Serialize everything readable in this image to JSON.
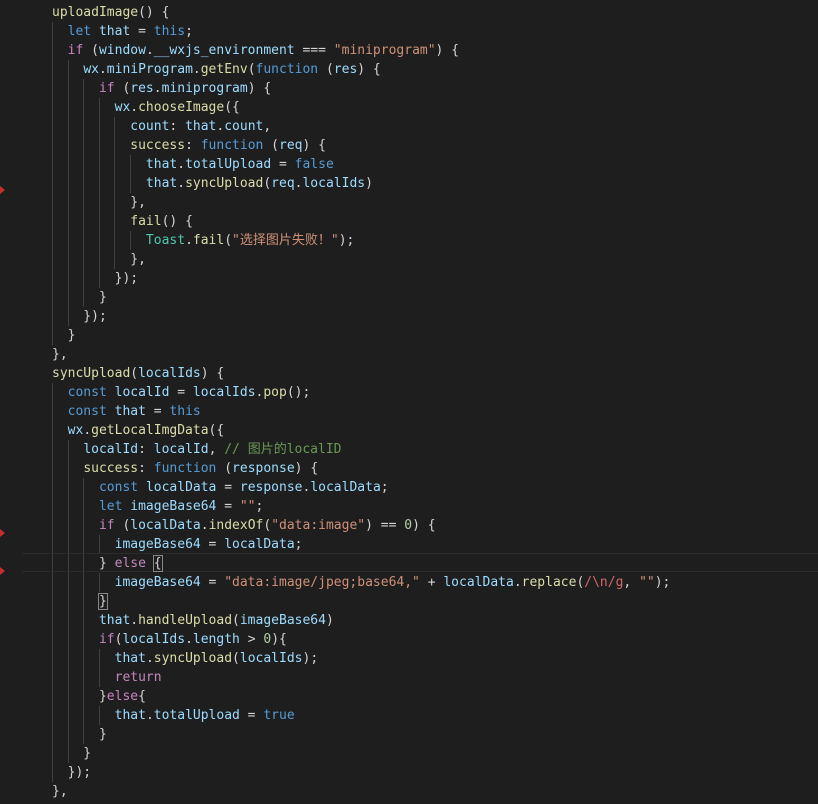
{
  "editor": {
    "theme_colors": {
      "background": "#1e1e1e",
      "function": "#dcdcaa",
      "keyword": "#569cd6",
      "control": "#c586c0",
      "variable": "#9cdcfe",
      "string": "#ce9178",
      "number": "#b5cea8",
      "comment": "#6a9955",
      "class": "#4ec9b0",
      "regex": "#d16969",
      "breakpoint_marker": "#c72e2e"
    },
    "lines": [
      [
        [
          "uploadImage",
          "fn"
        ],
        [
          "() {",
          "pl"
        ]
      ],
      [
        [
          "  ",
          "pl"
        ],
        [
          "let",
          "kw"
        ],
        [
          " ",
          "pl"
        ],
        [
          "that",
          "var"
        ],
        [
          " = ",
          "pl"
        ],
        [
          "this",
          "kw"
        ],
        [
          ";",
          "pl"
        ]
      ],
      [
        [
          "  ",
          "pl"
        ],
        [
          "if",
          "ctl"
        ],
        [
          " (",
          "pl"
        ],
        [
          "window",
          "var"
        ],
        [
          ".",
          "pl"
        ],
        [
          "__wxjs_environment",
          "var"
        ],
        [
          " === ",
          "pl"
        ],
        [
          "\"miniprogram\"",
          "str"
        ],
        [
          ") {",
          "pl"
        ]
      ],
      [
        [
          "    ",
          "pl"
        ],
        [
          "wx",
          "var"
        ],
        [
          ".",
          "pl"
        ],
        [
          "miniProgram",
          "var"
        ],
        [
          ".",
          "pl"
        ],
        [
          "getEnv",
          "fn"
        ],
        [
          "(",
          "pl"
        ],
        [
          "function",
          "kw"
        ],
        [
          " (",
          "pl"
        ],
        [
          "res",
          "var"
        ],
        [
          ") {",
          "pl"
        ]
      ],
      [
        [
          "      ",
          "pl"
        ],
        [
          "if",
          "ctl"
        ],
        [
          " (",
          "pl"
        ],
        [
          "res",
          "var"
        ],
        [
          ".",
          "pl"
        ],
        [
          "miniprogram",
          "var"
        ],
        [
          ") {",
          "pl"
        ]
      ],
      [
        [
          "        ",
          "pl"
        ],
        [
          "wx",
          "var"
        ],
        [
          ".",
          "pl"
        ],
        [
          "chooseImage",
          "fn"
        ],
        [
          "({",
          "pl"
        ]
      ],
      [
        [
          "          ",
          "pl"
        ],
        [
          "count",
          "var"
        ],
        [
          ": ",
          "pl"
        ],
        [
          "that",
          "var"
        ],
        [
          ".",
          "pl"
        ],
        [
          "count",
          "var"
        ],
        [
          ",",
          "pl"
        ]
      ],
      [
        [
          "          ",
          "pl"
        ],
        [
          "success",
          "fn"
        ],
        [
          ": ",
          "pl"
        ],
        [
          "function",
          "kw"
        ],
        [
          " (",
          "pl"
        ],
        [
          "req",
          "var"
        ],
        [
          ") {",
          "pl"
        ]
      ],
      [
        [
          "            ",
          "pl"
        ],
        [
          "that",
          "var"
        ],
        [
          ".",
          "pl"
        ],
        [
          "totalUpload",
          "var"
        ],
        [
          " = ",
          "pl"
        ],
        [
          "false",
          "kw"
        ]
      ],
      [
        [
          "            ",
          "pl"
        ],
        [
          "that",
          "var"
        ],
        [
          ".",
          "pl"
        ],
        [
          "syncUpload",
          "fn"
        ],
        [
          "(",
          "pl"
        ],
        [
          "req",
          "var"
        ],
        [
          ".",
          "pl"
        ],
        [
          "localIds",
          "var"
        ],
        [
          ")",
          "pl"
        ]
      ],
      [
        [
          "          },",
          "pl"
        ]
      ],
      [
        [
          "          ",
          "pl"
        ],
        [
          "fail",
          "fn"
        ],
        [
          "() {",
          "pl"
        ]
      ],
      [
        [
          "            ",
          "pl"
        ],
        [
          "Toast",
          "cls"
        ],
        [
          ".",
          "pl"
        ],
        [
          "fail",
          "fn"
        ],
        [
          "(",
          "pl"
        ],
        [
          "\"选择图片失败！\"",
          "str"
        ],
        [
          ");",
          "pl"
        ]
      ],
      [
        [
          "          },",
          "pl"
        ]
      ],
      [
        [
          "        });",
          "pl"
        ]
      ],
      [
        [
          "      }",
          "pl"
        ]
      ],
      [
        [
          "    });",
          "pl"
        ]
      ],
      [
        [
          "  }",
          "pl"
        ]
      ],
      [
        [
          "},",
          "pl"
        ]
      ],
      [
        [
          "syncUpload",
          "fn"
        ],
        [
          "(",
          "pl"
        ],
        [
          "localIds",
          "var"
        ],
        [
          ") {",
          "pl"
        ]
      ],
      [
        [
          "  ",
          "pl"
        ],
        [
          "const",
          "kw"
        ],
        [
          " ",
          "pl"
        ],
        [
          "localId",
          "var"
        ],
        [
          " = ",
          "pl"
        ],
        [
          "localIds",
          "var"
        ],
        [
          ".",
          "pl"
        ],
        [
          "pop",
          "fn"
        ],
        [
          "();",
          "pl"
        ]
      ],
      [
        [
          "  ",
          "pl"
        ],
        [
          "const",
          "kw"
        ],
        [
          " ",
          "pl"
        ],
        [
          "that",
          "var"
        ],
        [
          " = ",
          "pl"
        ],
        [
          "this",
          "kw"
        ]
      ],
      [
        [
          "  ",
          "pl"
        ],
        [
          "wx",
          "var"
        ],
        [
          ".",
          "pl"
        ],
        [
          "getLocalImgData",
          "fn"
        ],
        [
          "({",
          "pl"
        ]
      ],
      [
        [
          "    ",
          "pl"
        ],
        [
          "localId",
          "var"
        ],
        [
          ": ",
          "pl"
        ],
        [
          "localId",
          "var"
        ],
        [
          ", ",
          "pl"
        ],
        [
          "// 图片的localID",
          "cm"
        ]
      ],
      [
        [
          "    ",
          "pl"
        ],
        [
          "success",
          "fn"
        ],
        [
          ": ",
          "pl"
        ],
        [
          "function",
          "kw"
        ],
        [
          " (",
          "pl"
        ],
        [
          "response",
          "var"
        ],
        [
          ") {",
          "pl"
        ]
      ],
      [
        [
          "      ",
          "pl"
        ],
        [
          "const",
          "kw"
        ],
        [
          " ",
          "pl"
        ],
        [
          "localData",
          "var"
        ],
        [
          " = ",
          "pl"
        ],
        [
          "response",
          "var"
        ],
        [
          ".",
          "pl"
        ],
        [
          "localData",
          "var"
        ],
        [
          ";",
          "pl"
        ]
      ],
      [
        [
          "      ",
          "pl"
        ],
        [
          "let",
          "kw"
        ],
        [
          " ",
          "pl"
        ],
        [
          "imageBase64",
          "var"
        ],
        [
          " = ",
          "pl"
        ],
        [
          "\"\"",
          "str"
        ],
        [
          ";",
          "pl"
        ]
      ],
      [
        [
          "      ",
          "pl"
        ],
        [
          "if",
          "ctl"
        ],
        [
          " (",
          "pl"
        ],
        [
          "localData",
          "var"
        ],
        [
          ".",
          "pl"
        ],
        [
          "indexOf",
          "fn"
        ],
        [
          "(",
          "pl"
        ],
        [
          "\"data:image\"",
          "str"
        ],
        [
          ") == ",
          "pl"
        ],
        [
          "0",
          "num"
        ],
        [
          ") {",
          "pl"
        ]
      ],
      [
        [
          "        ",
          "pl"
        ],
        [
          "imageBase64",
          "var"
        ],
        [
          " = ",
          "pl"
        ],
        [
          "localData",
          "var"
        ],
        [
          ";",
          "pl"
        ]
      ],
      [
        [
          "      } ",
          "pl"
        ],
        [
          "else",
          "ctl"
        ],
        [
          " ",
          "pl"
        ],
        [
          "{",
          "brace"
        ]
      ],
      [
        [
          "        ",
          "pl"
        ],
        [
          "imageBase64",
          "var"
        ],
        [
          " = ",
          "pl"
        ],
        [
          "\"data:image/jpeg;base64,\"",
          "str"
        ],
        [
          " + ",
          "pl"
        ],
        [
          "localData",
          "var"
        ],
        [
          ".",
          "pl"
        ],
        [
          "replace",
          "fn"
        ],
        [
          "(",
          "pl"
        ],
        [
          "/\\n/g",
          "rx"
        ],
        [
          ", ",
          "pl"
        ],
        [
          "\"\"",
          "str"
        ],
        [
          ");",
          "pl"
        ]
      ],
      [
        [
          "      ",
          "pl"
        ],
        [
          "}",
          "brace"
        ]
      ],
      [
        [
          "      ",
          "pl"
        ],
        [
          "that",
          "var"
        ],
        [
          ".",
          "pl"
        ],
        [
          "handleUpload",
          "fn"
        ],
        [
          "(",
          "pl"
        ],
        [
          "imageBase64",
          "var"
        ],
        [
          ")",
          "pl"
        ]
      ],
      [
        [
          "      ",
          "pl"
        ],
        [
          "if",
          "ctl"
        ],
        [
          "(",
          "pl"
        ],
        [
          "localIds",
          "var"
        ],
        [
          ".",
          "pl"
        ],
        [
          "length",
          "var"
        ],
        [
          " > ",
          "pl"
        ],
        [
          "0",
          "num"
        ],
        [
          "){",
          "pl"
        ]
      ],
      [
        [
          "        ",
          "pl"
        ],
        [
          "that",
          "var"
        ],
        [
          ".",
          "pl"
        ],
        [
          "syncUpload",
          "fn"
        ],
        [
          "(",
          "pl"
        ],
        [
          "localIds",
          "var"
        ],
        [
          ");",
          "pl"
        ]
      ],
      [
        [
          "        ",
          "pl"
        ],
        [
          "return",
          "ctl"
        ]
      ],
      [
        [
          "      }",
          "pl"
        ],
        [
          "else",
          "ctl"
        ],
        [
          "{",
          "pl"
        ]
      ],
      [
        [
          "        ",
          "pl"
        ],
        [
          "that",
          "var"
        ],
        [
          ".",
          "pl"
        ],
        [
          "totalUpload",
          "var"
        ],
        [
          " = ",
          "pl"
        ],
        [
          "true",
          "kw"
        ]
      ],
      [
        [
          "      }",
          "pl"
        ]
      ],
      [
        [
          "    }",
          "pl"
        ]
      ],
      [
        [
          "  });",
          "pl"
        ]
      ],
      [
        [
          "},",
          "pl"
        ]
      ]
    ]
  }
}
